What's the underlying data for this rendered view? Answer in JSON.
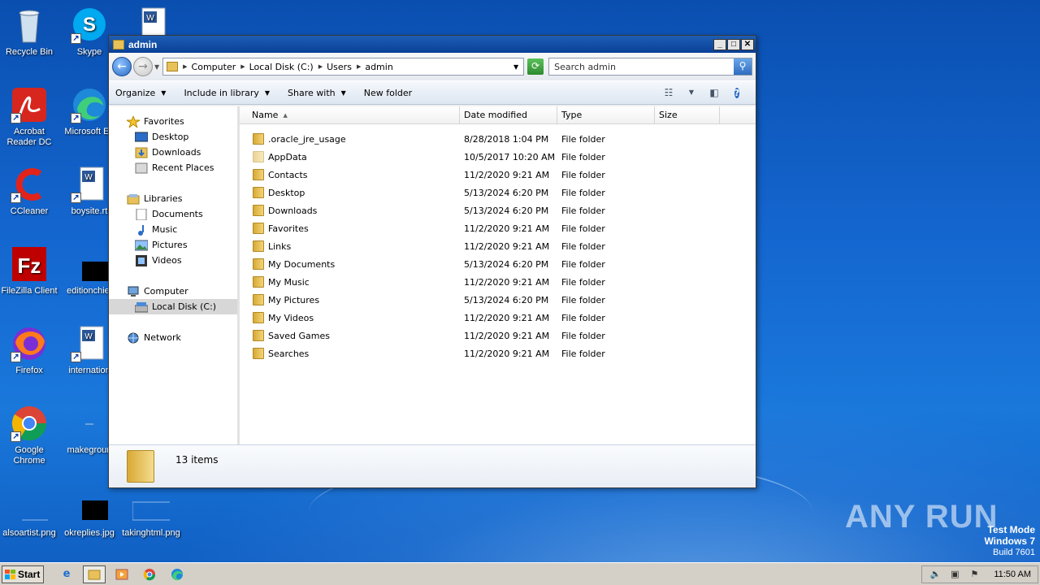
{
  "desktop": {
    "icons": [
      {
        "label": "Recycle Bin",
        "icon": "recycle-bin-icon"
      },
      {
        "label": "Skype",
        "icon": "skype-icon"
      },
      {
        "label": "Acrobat Reader DC",
        "icon": "acrobat-icon"
      },
      {
        "label": "Microsoft Ed",
        "icon": "edge-icon"
      },
      {
        "label": "CCleaner",
        "icon": "ccleaner-icon"
      },
      {
        "label": "boysite.rt",
        "icon": "word-doc-icon"
      },
      {
        "label": "FileZilla Client",
        "icon": "filezilla-icon"
      },
      {
        "label": "editionchief",
        "icon": "image-file-icon"
      },
      {
        "label": "Firefox",
        "icon": "firefox-icon"
      },
      {
        "label": "internation",
        "icon": "word-doc-icon"
      },
      {
        "label": "Google Chrome",
        "icon": "chrome-icon"
      },
      {
        "label": "makegroun",
        "icon": "image-file-icon"
      },
      {
        "label": "alsoartist.png",
        "icon": "image-file-icon"
      },
      {
        "label": "okreplies.jpg",
        "icon": "image-file-icon"
      },
      {
        "label": "takinghtml.png",
        "icon": "image-file-icon"
      }
    ]
  },
  "window": {
    "title": "admin",
    "controls": {
      "minimize": "_",
      "maximize": "□",
      "close": "✕"
    },
    "breadcrumb": [
      "Computer",
      "Local Disk (C:)",
      "Users",
      "admin"
    ],
    "search_placeholder": "Search admin",
    "toolbar": {
      "organize": "Organize",
      "include_in_library": "Include in library",
      "share_with": "Share with",
      "new_folder": "New folder"
    },
    "nav": {
      "favorites": "Favorites",
      "fav_items": [
        "Desktop",
        "Downloads",
        "Recent Places"
      ],
      "libraries": "Libraries",
      "lib_items": [
        "Documents",
        "Music",
        "Pictures",
        "Videos"
      ],
      "computer": "Computer",
      "computer_items": [
        "Local Disk (C:)"
      ],
      "network": "Network"
    },
    "columns": {
      "name": "Name",
      "date": "Date modified",
      "type": "Type",
      "size": "Size"
    },
    "files": [
      {
        "name": ".oracle_jre_usage",
        "date": "8/28/2018 1:04 PM",
        "type": "File folder"
      },
      {
        "name": "AppData",
        "date": "10/5/2017 10:20 AM",
        "type": "File folder"
      },
      {
        "name": "Contacts",
        "date": "11/2/2020 9:21 AM",
        "type": "File folder"
      },
      {
        "name": "Desktop",
        "date": "5/13/2024 6:20 PM",
        "type": "File folder"
      },
      {
        "name": "Downloads",
        "date": "5/13/2024 6:20 PM",
        "type": "File folder"
      },
      {
        "name": "Favorites",
        "date": "11/2/2020 9:21 AM",
        "type": "File folder"
      },
      {
        "name": "Links",
        "date": "11/2/2020 9:21 AM",
        "type": "File folder"
      },
      {
        "name": "My Documents",
        "date": "5/13/2024 6:20 PM",
        "type": "File folder"
      },
      {
        "name": "My Music",
        "date": "11/2/2020 9:21 AM",
        "type": "File folder"
      },
      {
        "name": "My Pictures",
        "date": "5/13/2024 6:20 PM",
        "type": "File folder"
      },
      {
        "name": "My Videos",
        "date": "11/2/2020 9:21 AM",
        "type": "File folder"
      },
      {
        "name": "Saved Games",
        "date": "11/2/2020 9:21 AM",
        "type": "File folder"
      },
      {
        "name": "Searches",
        "date": "11/2/2020 9:21 AM",
        "type": "File folder"
      }
    ],
    "status": "13 items"
  },
  "taskbar": {
    "start_label": "Start",
    "clock": "11:50 AM"
  },
  "watermark": {
    "line1": "Test Mode",
    "line2": "Windows 7",
    "line3": "Build 7601",
    "brand": "ANY RUN"
  },
  "colors": {
    "accent": "#1d5fb5",
    "folder": "#e8c15a"
  }
}
